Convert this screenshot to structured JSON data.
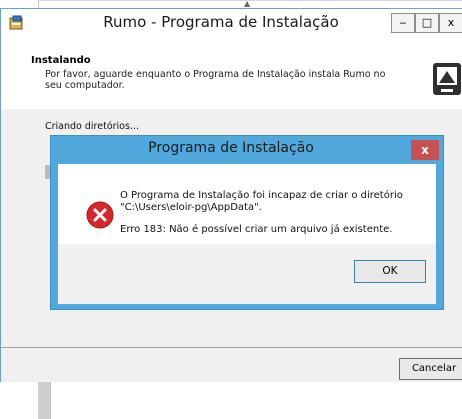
{
  "installer": {
    "title": "Rumo - Programa de Instalação",
    "minimize_label": "‒",
    "maximize_label": "□",
    "close_label": "x",
    "header_title": "Instalando",
    "header_subtitle": "Por favor, aguarde enquanto o Programa de Instalação instala Rumo no seu computador.",
    "status_text": "Criando diretórios...",
    "cancel_label": "Cancelar"
  },
  "dialog": {
    "title": "Programa de Instalação",
    "close_label": "x",
    "message_line1": "O Programa de Instalação foi incapaz de criar o diretório \"C:\\Users\\eloir-pg\\AppData\".",
    "message_line2": "Erro 183: Não é possível criar um arquivo já existente.",
    "ok_label": "OK",
    "icon": "error-icon"
  },
  "colors": {
    "dialog_frame": "#51a8dd",
    "close_button": "#c75050",
    "error_red": "#d9262b"
  }
}
